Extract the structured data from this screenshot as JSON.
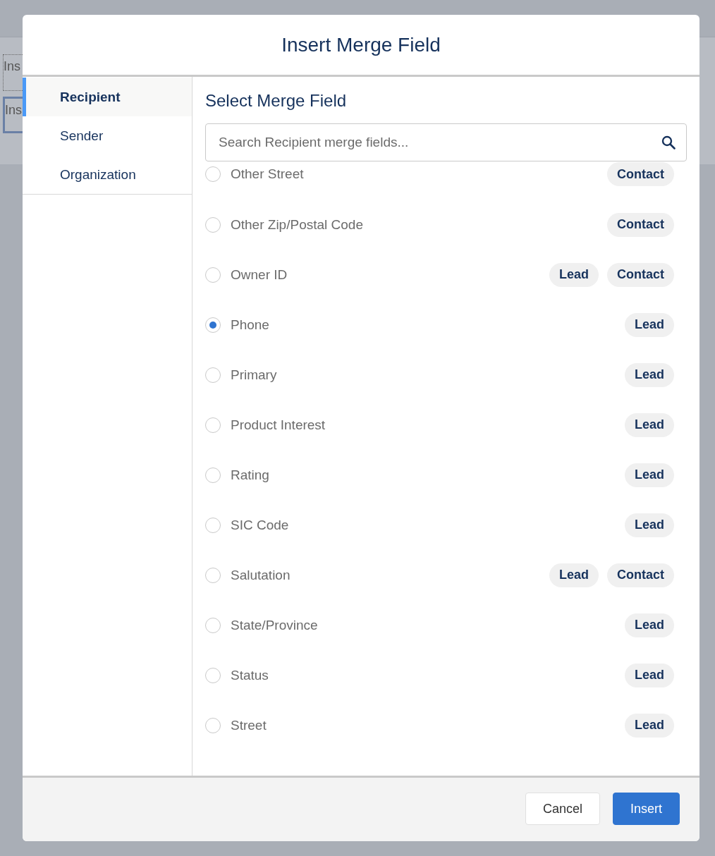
{
  "background": {
    "fields": [
      {
        "text": "Ins",
        "focused": false
      },
      {
        "text": "Ins",
        "focused": true
      }
    ]
  },
  "dialog": {
    "title": "Insert Merge Field",
    "nav": [
      {
        "label": "Recipient",
        "selected": true
      },
      {
        "label": "Sender",
        "selected": false
      },
      {
        "label": "Organization",
        "selected": false
      }
    ],
    "heading": "Select Merge Field",
    "search": {
      "placeholder": "Search Recipient merge fields..."
    },
    "fields": [
      {
        "name": "Other Street",
        "selected": false,
        "tags": [
          "Contact"
        ]
      },
      {
        "name": "Other Zip/Postal Code",
        "selected": false,
        "tags": [
          "Contact"
        ]
      },
      {
        "name": "Owner ID",
        "selected": false,
        "tags": [
          "Lead",
          "Contact"
        ]
      },
      {
        "name": "Phone",
        "selected": true,
        "tags": [
          "Lead"
        ]
      },
      {
        "name": "Primary",
        "selected": false,
        "tags": [
          "Lead"
        ]
      },
      {
        "name": "Product Interest",
        "selected": false,
        "tags": [
          "Lead"
        ]
      },
      {
        "name": "Rating",
        "selected": false,
        "tags": [
          "Lead"
        ]
      },
      {
        "name": "SIC Code",
        "selected": false,
        "tags": [
          "Lead"
        ]
      },
      {
        "name": "Salutation",
        "selected": false,
        "tags": [
          "Lead",
          "Contact"
        ]
      },
      {
        "name": "State/Province",
        "selected": false,
        "tags": [
          "Lead"
        ]
      },
      {
        "name": "Status",
        "selected": false,
        "tags": [
          "Lead"
        ]
      },
      {
        "name": "Street",
        "selected": false,
        "tags": [
          "Lead"
        ]
      }
    ],
    "buttons": [
      {
        "label": "Cancel",
        "kind": "secondary"
      },
      {
        "label": "Insert",
        "kind": "primary"
      }
    ]
  }
}
